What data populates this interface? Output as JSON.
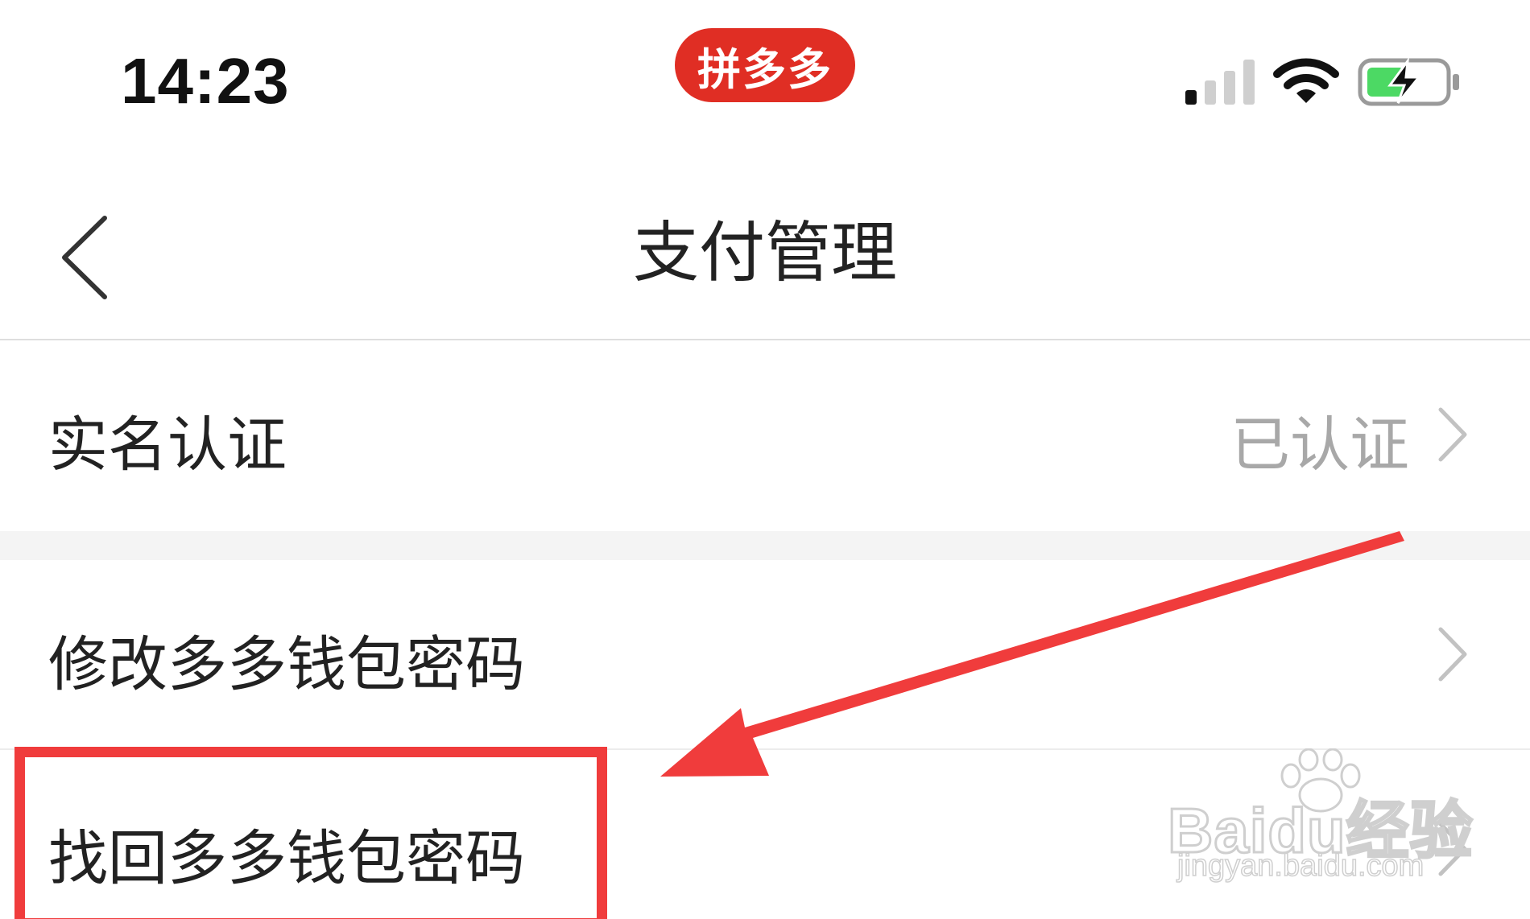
{
  "status_bar": {
    "time": "14:23",
    "app_badge": "拼多多",
    "signal_icon": "cellular-signal-icon",
    "wifi_icon": "wifi-icon",
    "battery_icon": "battery-charging-icon",
    "battery_color": "#4cd964"
  },
  "nav": {
    "back_icon": "chevron-left-icon",
    "title": "支付管理"
  },
  "rows": [
    {
      "label": "实名认证",
      "value": "已认证",
      "icon": "chevron-right-icon"
    },
    {
      "label": "修改多多钱包密码",
      "icon": "chevron-right-icon"
    },
    {
      "label": "找回多多钱包密码",
      "icon": "chevron-right-icon",
      "highlighted": true
    }
  ],
  "annotation": {
    "color": "#f03c3c",
    "arrow_icon": "arrow-icon"
  },
  "watermark": {
    "logo": "Baidu经验",
    "url": "jingyan.baidu.com"
  },
  "colors": {
    "brand_red": "#e02e24",
    "text_primary": "#222222",
    "text_secondary": "#a8a8a8",
    "section_bg": "#f4f4f4"
  }
}
